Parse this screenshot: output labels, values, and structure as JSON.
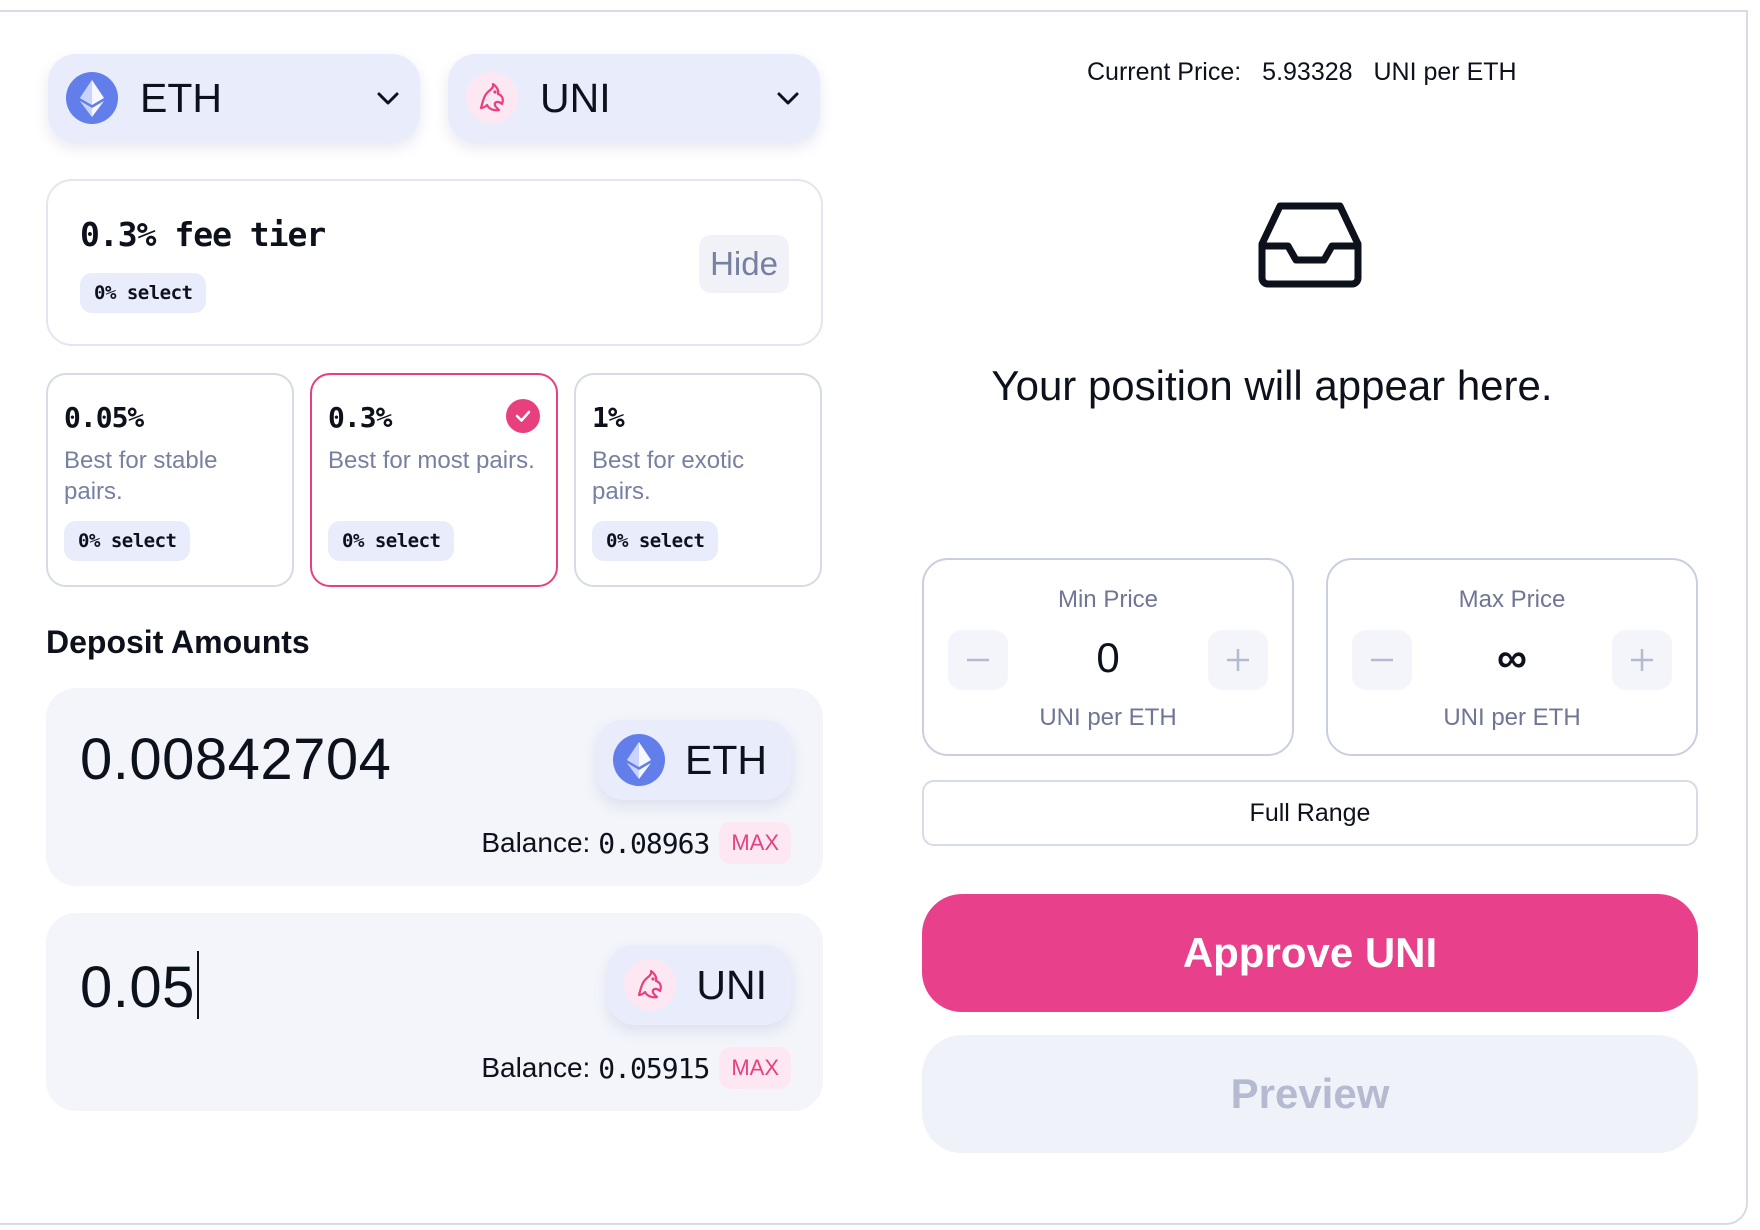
{
  "token_a": {
    "symbol": "ETH",
    "icon": "ethereum-icon"
  },
  "token_b": {
    "symbol": "UNI",
    "icon": "uniswap-icon"
  },
  "fee_tier": {
    "title": "0.3% fee tier",
    "select_badge": "0% select",
    "hide_label": "Hide"
  },
  "fee_options": [
    {
      "pct": "0.05%",
      "desc": "Best for stable pairs.",
      "badge": "0% select",
      "selected": false
    },
    {
      "pct": "0.3%",
      "desc": "Best for most pairs.",
      "badge": "0% select",
      "selected": true
    },
    {
      "pct": "1%",
      "desc": "Best for exotic pairs.",
      "badge": "0% select",
      "selected": false
    }
  ],
  "deposit": {
    "title": "Deposit Amounts",
    "inputs": [
      {
        "amount": "0.00842704",
        "token": "ETH",
        "balance_label": "Balance:",
        "balance": "0.08963",
        "max_label": "MAX"
      },
      {
        "amount": "0.05",
        "token": "UNI",
        "balance_label": "Balance:",
        "balance": "0.05915",
        "max_label": "MAX"
      }
    ]
  },
  "price": {
    "label": "Current Price:",
    "value": "5.93328",
    "unit": "UNI per ETH"
  },
  "position_placeholder": "Your position will appear here.",
  "range": {
    "min": {
      "label": "Min Price",
      "value": "0",
      "unit": "UNI per ETH"
    },
    "max": {
      "label": "Max Price",
      "value": "∞",
      "unit": "UNI per ETH"
    }
  },
  "full_range_label": "Full Range",
  "approve_label": "Approve UNI",
  "preview_label": "Preview",
  "colors": {
    "accent": "#e8408a",
    "token_bg": "#e8ecfb",
    "eth": "#627eea"
  }
}
